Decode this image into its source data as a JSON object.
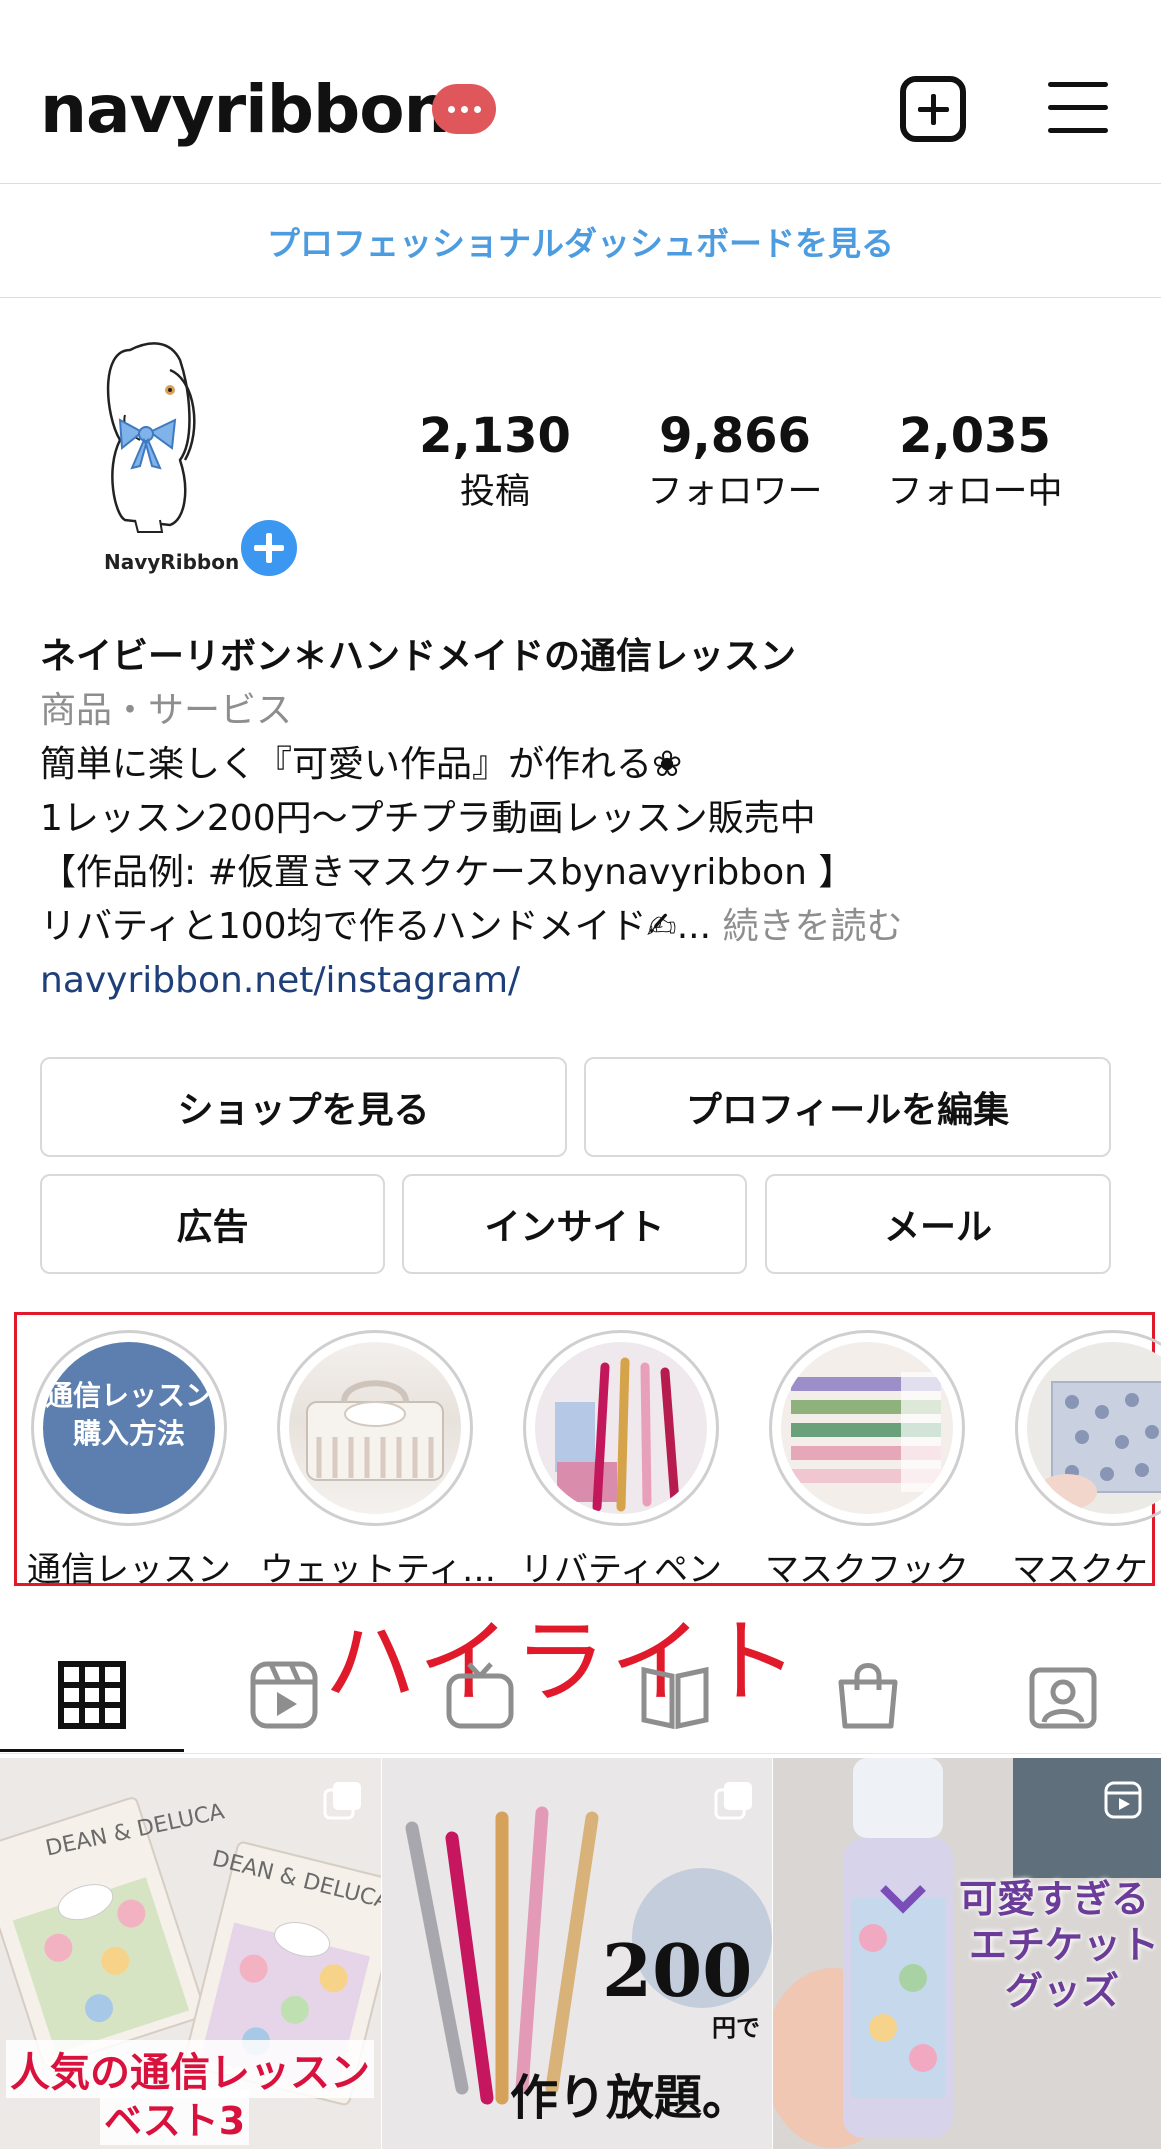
{
  "header": {
    "username": "navyribbon",
    "notification_dots": "•••",
    "add_icon": "plus-square-icon",
    "menu_icon": "hamburger-menu-icon"
  },
  "dashboard": {
    "link": "プロフェッショナルダッシュボードを見る"
  },
  "profile": {
    "avatar_text": "NavyRibbon",
    "stats": [
      {
        "value": "2,130",
        "label": "投稿"
      },
      {
        "value": "9,866",
        "label": "フォロワー"
      },
      {
        "value": "2,035",
        "label": "フォロー中"
      }
    ]
  },
  "bio": {
    "name": "ネイビーリボン＊ハンドメイドの通信レッスン",
    "category": "商品・サービス",
    "line1": "簡単に楽しく『可愛い作品』が作れる❀",
    "line2": "1レッスン200円〜プチプラ動画レッスン販売中",
    "line3": "【作品例: #仮置きマスクケースbynavyribbon 】",
    "line4": "リバティと100均で作るハンドメイド✍...",
    "more": " 続きを読む",
    "link": "navyribbon.net/instagram/"
  },
  "buttons": {
    "shop": "ショップを見る",
    "edit_profile": "プロフィールを編集",
    "ads": "広告",
    "insights": "インサイト",
    "email": "メール"
  },
  "highlights": {
    "items": [
      {
        "label": "通信レッスン",
        "cover_text_1": "通信レッスン",
        "cover_text_2": "購入方法"
      },
      {
        "label": "ウェットティ…"
      },
      {
        "label": "リバティペン"
      },
      {
        "label": "マスクフック"
      },
      {
        "label": "マスクケ"
      }
    ]
  },
  "annotation": "ハイライト",
  "tabs": [
    "grid-icon",
    "reels-icon",
    "igtv-icon",
    "guides-icon",
    "shopping-bag-icon",
    "tagged-icon"
  ],
  "posts": [
    {
      "caption_1": "人気の通信レッスン",
      "caption_2": "ベスト3",
      "bag_text_1": "DEAN & DELUCA",
      "bag_text_2": "DEAN & DELUCA",
      "badge": "multiple-posts-icon"
    },
    {
      "caption_1": "200",
      "caption_2": "円で",
      "caption_3": "作り放題。",
      "badge": "multiple-posts-icon"
    },
    {
      "caption_1": "可愛すぎる",
      "caption_2": "エチケット",
      "caption_3": "グッズ",
      "badge": "reels-icon"
    }
  ],
  "colors": {
    "link_blue": "#4d9ce0",
    "bio_link": "#1e3f7a",
    "notification_red": "#e0575b",
    "annotation_red": "#e01a2b",
    "add_blue": "#3b97f0",
    "highlight_cover_blue": "#5c7fb0"
  }
}
